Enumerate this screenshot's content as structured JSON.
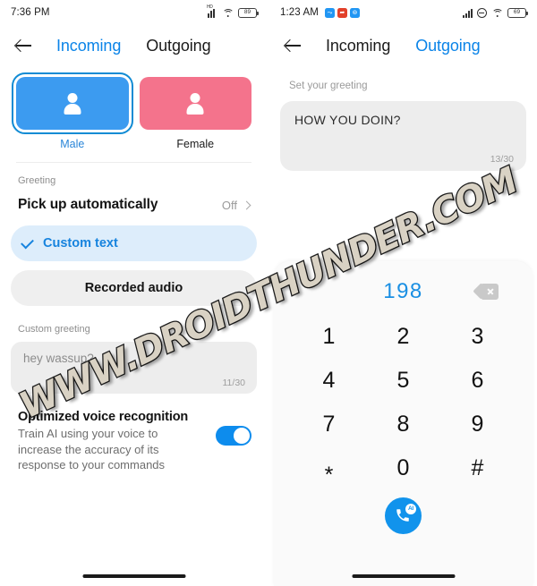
{
  "left_panel": {
    "status_bar": {
      "time": "7:36 PM",
      "network_tag": "HD",
      "battery_level": "89",
      "icons": [
        "signal-icon",
        "wifi-icon",
        "battery-icon"
      ]
    },
    "header": {
      "back_icon": "back-arrow-icon",
      "tab_incoming": "Incoming",
      "tab_outgoing": "Outgoing",
      "active_tab": "Incoming"
    },
    "gender": {
      "male_label": "Male",
      "female_label": "Female",
      "selected": "Male",
      "male_color": "#3c9bf0",
      "female_color": "#f4738c",
      "selection_ring_color": "#108bd4"
    },
    "greeting_section_label": "Greeting",
    "pickup_row": {
      "title": "Pick up automatically",
      "value": "Off",
      "chevron": "chevron-right-icon"
    },
    "options": [
      {
        "label": "Custom text",
        "selected": true
      },
      {
        "label": "Recorded audio",
        "selected": false
      }
    ],
    "custom_greeting": {
      "label": "Custom greeting",
      "value": "hey wassup?",
      "counter": "11/30"
    },
    "voice_recognition": {
      "title": "Optimized voice recognition",
      "subtitle": "Train AI using your voice to increase the accuracy of its response to your commands",
      "toggle_on": true,
      "toggle_color": "#0d8ced"
    }
  },
  "right_panel": {
    "status_bar": {
      "time": "1:23 AM",
      "battery_level": "69",
      "app_icons": [
        {
          "name": "share-app-icon",
          "color": "#2196f3",
          "glyph": "⤳"
        },
        {
          "name": "export-app-icon",
          "color": "#e2402a",
          "glyph": "➦"
        },
        {
          "name": "sync-app-icon",
          "color": "#2196f3",
          "glyph": "⊚"
        }
      ],
      "icons": [
        "signal-icon",
        "vibrate-icon",
        "wifi-icon",
        "battery-icon"
      ]
    },
    "header": {
      "back_icon": "back-arrow-icon",
      "tab_incoming": "Incoming",
      "tab_outgoing": "Outgoing",
      "active_tab": "Outgoing"
    },
    "greeting": {
      "label": "Set your greeting",
      "value": "HOW YOU DOIN?",
      "counter": "13/30"
    },
    "dialer": {
      "number": "198",
      "backspace_icon": "backspace-icon",
      "keys": [
        "1",
        "2",
        "3",
        "4",
        "5",
        "6",
        "7",
        "8",
        "9",
        "*",
        "0",
        "#"
      ],
      "call_button": {
        "name": "ai-call-button",
        "badge": "AI",
        "color": "#1193ec"
      }
    }
  },
  "watermark": {
    "text": "WWW.DROIDTHUNDER.COM"
  }
}
